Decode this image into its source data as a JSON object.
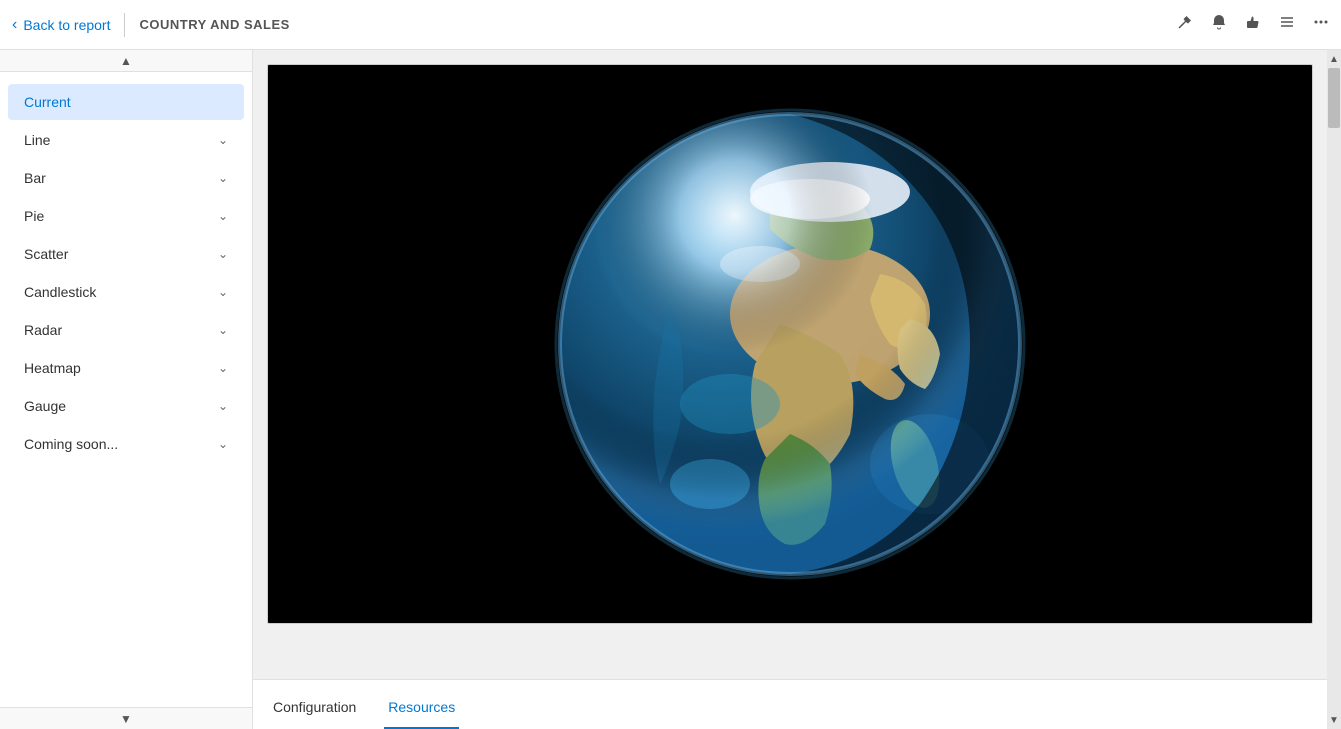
{
  "topbar": {
    "back_label": "Back to report",
    "page_title": "COUNTRY AND SALES",
    "icons": [
      {
        "name": "pin-icon",
        "symbol": "📌"
      },
      {
        "name": "bell-icon",
        "symbol": "🔔"
      },
      {
        "name": "like-icon",
        "symbol": "👍"
      },
      {
        "name": "menu-icon",
        "symbol": "☰"
      },
      {
        "name": "more-icon",
        "symbol": "···"
      }
    ]
  },
  "sidebar": {
    "items": [
      {
        "id": "current",
        "label": "Current",
        "active": true,
        "hasChevron": false
      },
      {
        "id": "line",
        "label": "Line",
        "active": false,
        "hasChevron": true
      },
      {
        "id": "bar",
        "label": "Bar",
        "active": false,
        "hasChevron": true
      },
      {
        "id": "pie",
        "label": "Pie",
        "active": false,
        "hasChevron": true
      },
      {
        "id": "scatter",
        "label": "Scatter",
        "active": false,
        "hasChevron": true
      },
      {
        "id": "candlestick",
        "label": "Candlestick",
        "active": false,
        "hasChevron": true
      },
      {
        "id": "radar",
        "label": "Radar",
        "active": false,
        "hasChevron": true
      },
      {
        "id": "heatmap",
        "label": "Heatmap",
        "active": false,
        "hasChevron": true
      },
      {
        "id": "gauge",
        "label": "Gauge",
        "active": false,
        "hasChevron": true
      },
      {
        "id": "coming-soon",
        "label": "Coming soon...",
        "active": false,
        "hasChevron": true
      }
    ]
  },
  "tabs": [
    {
      "id": "configuration",
      "label": "Configuration",
      "active": false
    },
    {
      "id": "resources",
      "label": "Resources",
      "active": true
    }
  ],
  "colors": {
    "active_tab_color": "#0078d4",
    "active_sidebar_bg": "#dbeafe",
    "active_sidebar_text": "#0078d4"
  }
}
